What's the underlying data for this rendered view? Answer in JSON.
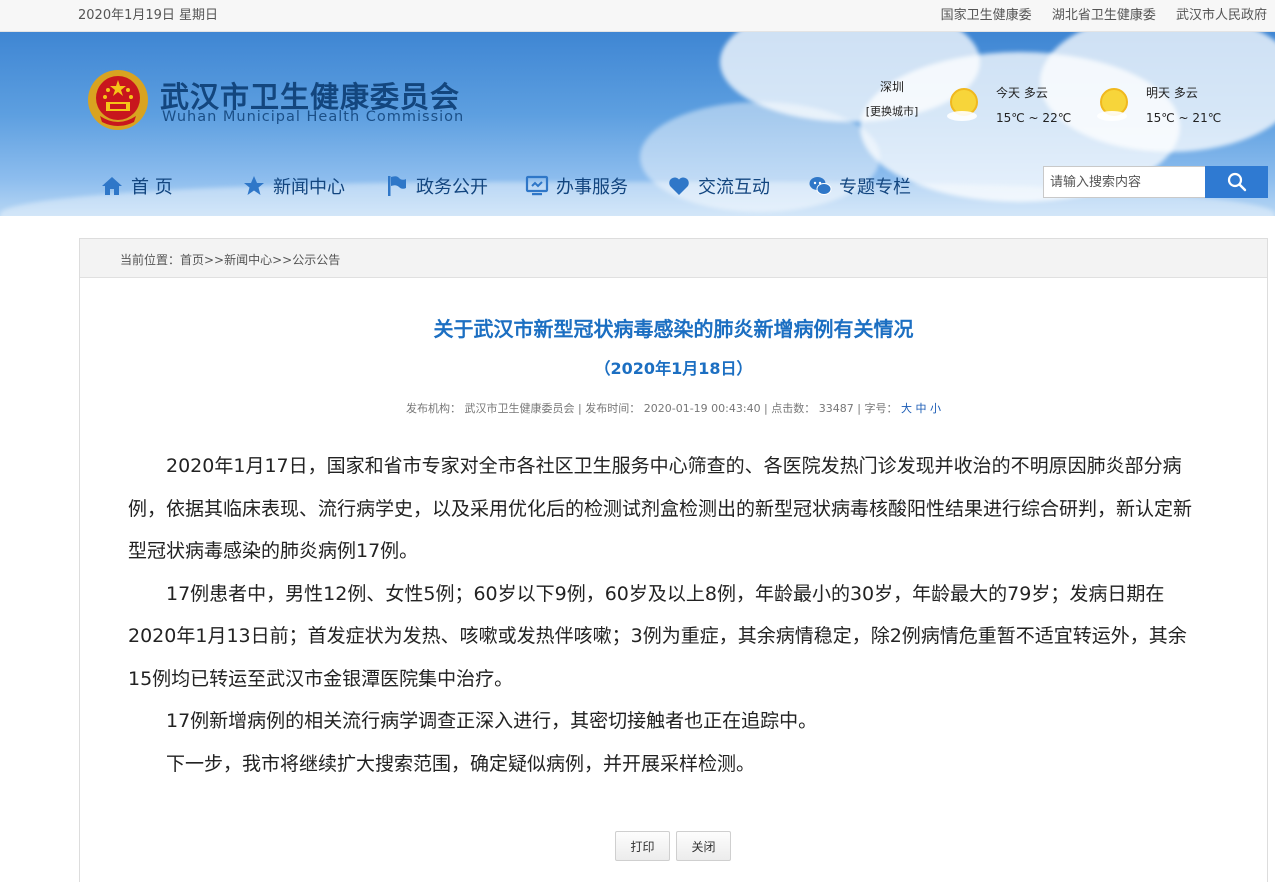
{
  "topbar": {
    "date": "2020年1月19日 星期日",
    "links": [
      "国家卫生健康委",
      "湖北省卫生健康委",
      "武汉市人民政府"
    ]
  },
  "header": {
    "title_cn": "武汉市卫生健康委员会",
    "title_en": "Wuhan Municipal Health Commission",
    "colors": {
      "title": "#13467e",
      "header_bg": "#5d9fe0"
    }
  },
  "weather": {
    "city": "深圳",
    "change_city": "[更换城市]",
    "today": {
      "label": "今天  多云",
      "temp": "15℃ ~ 22℃",
      "icon": "sun-cloud-icon"
    },
    "tomorrow": {
      "label": "明天  多云",
      "temp": "15℃ ~ 21℃",
      "icon": "sun-cloud-icon"
    }
  },
  "nav": {
    "items": [
      {
        "label": "首  页",
        "icon": "home-icon"
      },
      {
        "label": "新闻中心",
        "icon": "star-icon"
      },
      {
        "label": "政务公开",
        "icon": "flag-icon"
      },
      {
        "label": "办事服务",
        "icon": "monitor-icon"
      },
      {
        "label": "交流互动",
        "icon": "heart-icon"
      },
      {
        "label": "专题专栏",
        "icon": "chat-icon"
      }
    ]
  },
  "search": {
    "placeholder": "请输入搜索内容",
    "button_icon": "search-icon"
  },
  "breadcrumb": {
    "text": "当前位置：首页>>新闻中心>>公示公告"
  },
  "article": {
    "title": "关于武汉市新型冠状病毒感染的肺炎新增病例有关情况",
    "date": "（2020年1月18日）",
    "meta": {
      "publisher": "发布机构：  武汉市卫生健康委员会  |  发布时间：  2020-01-19 00:43:40  |  点击数：  33487  |  字号：",
      "font_sizes": "大 中 小"
    },
    "paragraphs": [
      "2020年1月17日，国家和省市专家对全市各社区卫生服务中心筛查的、各医院发热门诊发现并收治的不明原因肺炎部分病例，依据其临床表现、流行病学史，以及采用优化后的检测试剂盒检测出的新型冠状病毒核酸阳性结果进行综合研判，新认定新型冠状病毒感染的肺炎病例17例。",
      "17例患者中，男性12例、女性5例；60岁以下9例，60岁及以上8例，年龄最小的30岁，年龄最大的79岁；发病日期在2020年1月13日前；首发症状为发热、咳嗽或发热伴咳嗽；3例为重症，其余病情稳定，除2例病情危重暂不适宜转运外，其余15例均已转运至武汉市金银潭医院集中治疗。",
      "17例新增病例的相关流行病学调查正深入进行，其密切接触者也正在追踪中。",
      "下一步，我市将继续扩大搜索范围，确定疑似病例，并开展采样检测。"
    ],
    "accent_color": "#1c6fc2"
  },
  "actions": {
    "print": "打印",
    "close": "关闭"
  }
}
